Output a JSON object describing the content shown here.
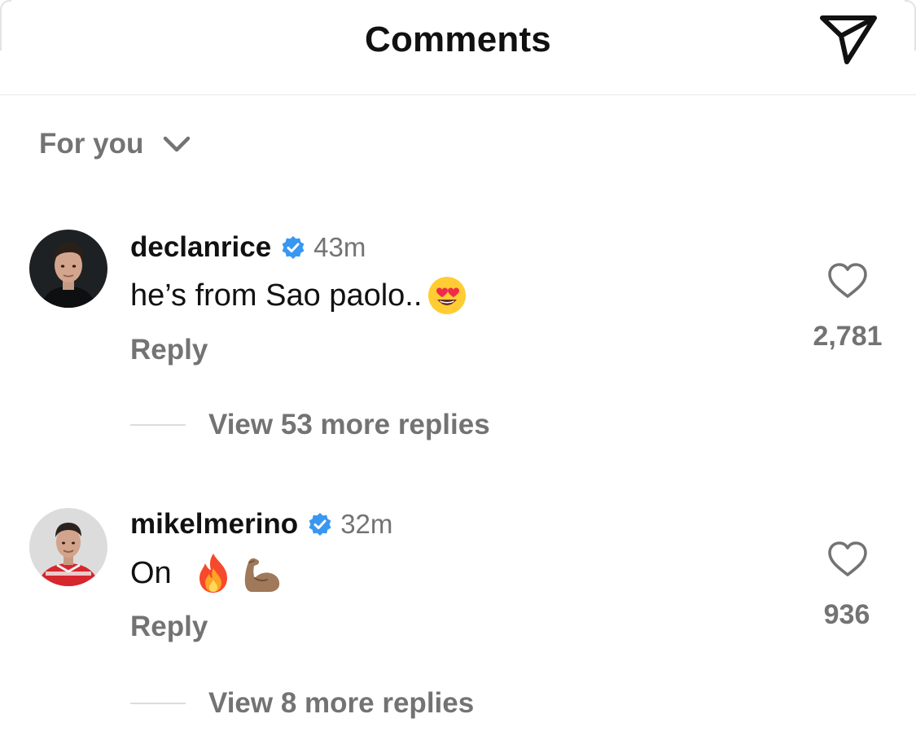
{
  "header": {
    "title": "Comments",
    "share_icon": "paper-plane-icon"
  },
  "sort": {
    "label": "For you",
    "icon": "chevron-down-icon"
  },
  "comments": [
    {
      "username": "declanrice",
      "verified": true,
      "time": "43m",
      "text": "he’s from Sao paolo..",
      "emojis": [
        "heart-eyes-emoji"
      ],
      "reply_label": "Reply",
      "like_count": "2,781",
      "view_replies": "View 53 more replies"
    },
    {
      "username": "mikelmerino",
      "verified": true,
      "time": "32m",
      "text": "On",
      "emojis": [
        "fire-emoji",
        "flexed-biceps-emoji"
      ],
      "reply_label": "Reply",
      "like_count": "936",
      "view_replies": "View 8 more replies"
    }
  ],
  "colors": {
    "text_primary": "#111111",
    "text_secondary": "#737373",
    "verified_blue": "#3897f0",
    "divider": "#e6e6e6"
  }
}
